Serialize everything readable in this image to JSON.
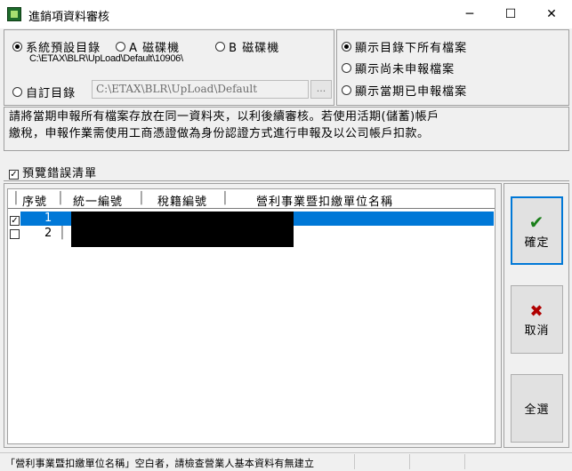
{
  "window": {
    "title": "進銷項資料審核",
    "min_glyph": "─",
    "max_glyph": "☐",
    "close_glyph": "✕",
    "icon": "app-icon"
  },
  "source": {
    "options": [
      {
        "label": "系統預設目錄",
        "selected": true
      },
      {
        "label": "A 磁碟機",
        "selected": false
      },
      {
        "label": "B 磁碟機",
        "selected": false
      }
    ],
    "default_path": "C:\\ETAX\\BLR\\UpLoad\\Default\\10906\\",
    "custom_label": "自訂目錄",
    "custom_path": "C:\\ETAX\\BLR\\UpLoad\\Default",
    "browse_label": "..."
  },
  "filter": {
    "options": [
      {
        "label": "顯示目錄下所有檔案",
        "selected": true
      },
      {
        "label": "顯示尚未申報檔案",
        "selected": false
      },
      {
        "label": "顯示當期已申報檔案",
        "selected": false
      }
    ]
  },
  "notice": {
    "line1": "請將當期申報所有檔案存放在同一資料夾，以利後續審核。若使用活期(儲蓄)帳戶",
    "line2": "繳稅，申報作業需使用工商憑證做為身份認證方式進行申報及以公司帳戶扣款。"
  },
  "preview": {
    "label": "預覽錯誤清單",
    "checked": true
  },
  "grid": {
    "columns": [
      "序號",
      "統一編號",
      "稅籍編號",
      "營利事業暨扣繳單位名稱"
    ],
    "rows": [
      {
        "checked": true,
        "no": "1",
        "selected": true
      },
      {
        "checked": false,
        "no": "2",
        "selected": false
      }
    ]
  },
  "buttons": {
    "ok": {
      "label": "確定",
      "icon": "check-icon",
      "color": "#1a7f1a"
    },
    "cancel": {
      "label": "取消",
      "icon": "x-icon",
      "color": "#b00000"
    },
    "select_all": {
      "label": "全選"
    }
  },
  "status": {
    "text": "「營利事業暨扣繳單位名稱」空白者，請檢查營業人基本資料有無建立"
  },
  "colors": {
    "selection": "#0078d7",
    "redaction": "#000000"
  }
}
